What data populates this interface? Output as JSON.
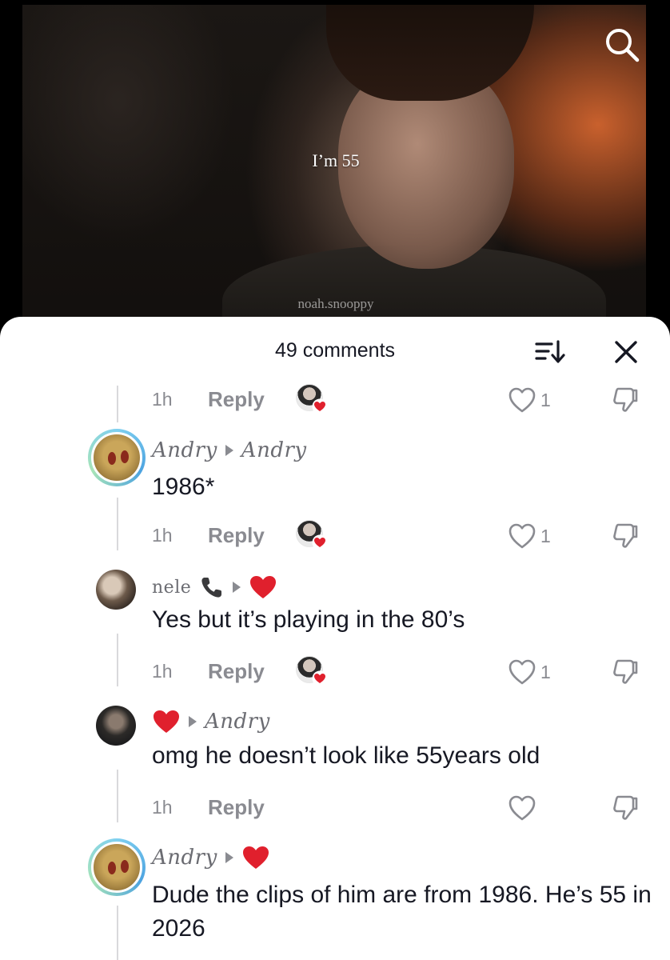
{
  "video": {
    "caption": "I’m 55",
    "watermark": "noah.snooppy"
  },
  "sheet": {
    "title": "49 comments"
  },
  "rows": [
    {
      "time": "1h",
      "reply": "Reply",
      "likes": "1"
    },
    {
      "time": "1h",
      "reply": "Reply",
      "likes": "1"
    },
    {
      "time": "1h",
      "reply": "Reply",
      "likes": "1"
    },
    {
      "time": "1h",
      "reply": "Reply",
      "likes": ""
    }
  ],
  "comments": [
    {
      "author": "Andry",
      "reply_to": "Andry",
      "text": "1986*"
    },
    {
      "author": "nele",
      "reply_to": "",
      "text": "Yes but it’s playing in the 80’s"
    },
    {
      "author": "",
      "reply_to": "Andry",
      "text": "omg he doesn’t look like 55years old"
    },
    {
      "author": "Andry",
      "reply_to": "",
      "text": "Dude the clips of him are from 1986. He’s 55 in 2026"
    }
  ],
  "colors": {
    "heart": "#e0202d",
    "meta_gray": "#8a8b91",
    "text": "#161823"
  }
}
